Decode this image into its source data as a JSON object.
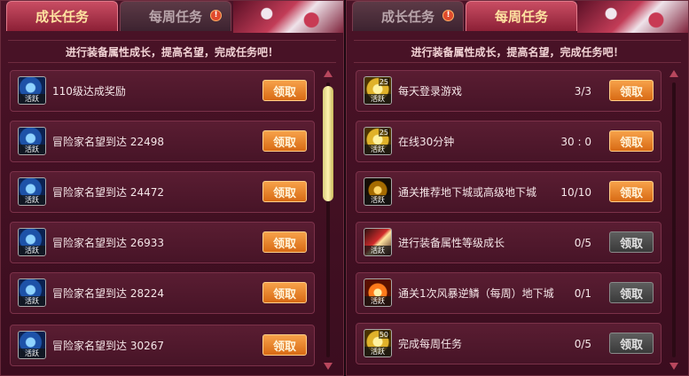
{
  "left_panel": {
    "tabs": [
      {
        "label": "成长任务",
        "active": true
      },
      {
        "label": "每周任务",
        "active": false,
        "alert": "!"
      }
    ],
    "banner": "进行装备属性成长，提高名望，完成任务吧！",
    "rows": [
      {
        "label": "110级达成奖励",
        "icon": "blue-swirl-icon",
        "icon_tag": "活跃",
        "button": "领取",
        "button_state": "enabled"
      },
      {
        "label": "冒险家名望到达 22498",
        "icon": "blue-swirl-icon",
        "icon_tag": "活跃",
        "button": "领取",
        "button_state": "enabled"
      },
      {
        "label": "冒险家名望到达 24472",
        "icon": "blue-swirl-icon",
        "icon_tag": "活跃",
        "button": "领取",
        "button_state": "enabled"
      },
      {
        "label": "冒险家名望到达 26933",
        "icon": "blue-swirl-icon",
        "icon_tag": "活跃",
        "button": "领取",
        "button_state": "enabled"
      },
      {
        "label": "冒险家名望到达 28224",
        "icon": "blue-swirl-icon",
        "icon_tag": "活跃",
        "button": "领取",
        "button_state": "enabled"
      },
      {
        "label": "冒险家名望到达 30267",
        "icon": "blue-swirl-icon",
        "icon_tag": "活跃",
        "button": "领取",
        "button_state": "enabled"
      }
    ]
  },
  "right_panel": {
    "tabs": [
      {
        "label": "成长任务",
        "active": false,
        "alert": "!"
      },
      {
        "label": "每周任务",
        "active": true
      }
    ],
    "banner": "进行装备属性成长，提高名望，完成任务吧！",
    "rows": [
      {
        "label": "每天登录游戏",
        "progress": "3/3",
        "icon": "gold-coin-icon",
        "icon_num": "25",
        "icon_tag": "活跃",
        "button": "领取",
        "button_state": "enabled"
      },
      {
        "label": "在线30分钟",
        "progress": "30 : 0",
        "icon": "gold-coin-icon",
        "icon_num": "25",
        "icon_tag": "活跃",
        "button": "领取",
        "button_state": "enabled"
      },
      {
        "label": "通关推荐地下城或高级地下城",
        "progress": "10/10",
        "icon": "dark-gem-icon",
        "icon_tag": "活跃",
        "button": "领取",
        "button_state": "enabled"
      },
      {
        "label": "进行装备属性等级成长",
        "progress": "0/5",
        "icon": "red-sword-icon",
        "icon_tag": "活跃",
        "button": "领取",
        "button_state": "disabled"
      },
      {
        "label": "通关1次风暴逆鳞（每周）地下城",
        "progress": "0/1",
        "icon": "fire-burst-icon",
        "icon_tag": "活跃",
        "button": "领取",
        "button_state": "disabled"
      },
      {
        "label": "完成每周任务",
        "progress": "0/5",
        "icon": "gold-coin-icon",
        "icon_num": "50",
        "icon_tag": "活跃",
        "button": "领取",
        "button_state": "disabled"
      }
    ]
  },
  "colors": {
    "active_button": "#e8842c",
    "disabled_button": "#4a4a4a",
    "panel_bg": "#42102a",
    "active_tab_text": "#ffe3a1"
  }
}
